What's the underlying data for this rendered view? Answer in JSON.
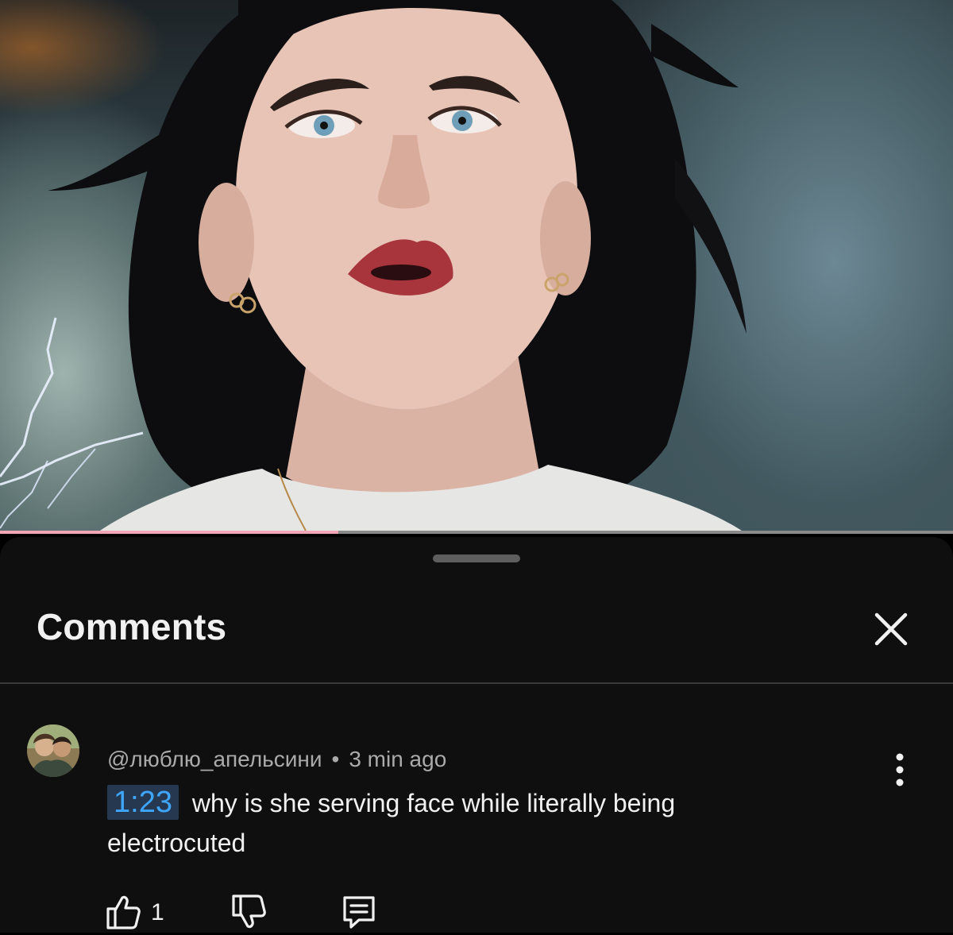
{
  "video": {
    "progress_fraction": 0.355,
    "progress_color": "#f0a6b4"
  },
  "sheet": {
    "title": "Comments",
    "close_icon": "close-icon"
  },
  "comment": {
    "author": "@люблю_апельсини",
    "separator": "•",
    "time_ago": "3 min ago",
    "timestamp_link": "1:23",
    "text": "why is she serving face while literally being electrocuted",
    "like_count": "1",
    "icons": [
      "thumbs-up-icon",
      "thumbs-down-icon",
      "reply-icon",
      "more-vert-icon"
    ]
  },
  "colors": {
    "sheet_background": "#0f0f0f",
    "timestamp_link": "#3ea6ff",
    "secondary_text": "#aaaaaa"
  }
}
